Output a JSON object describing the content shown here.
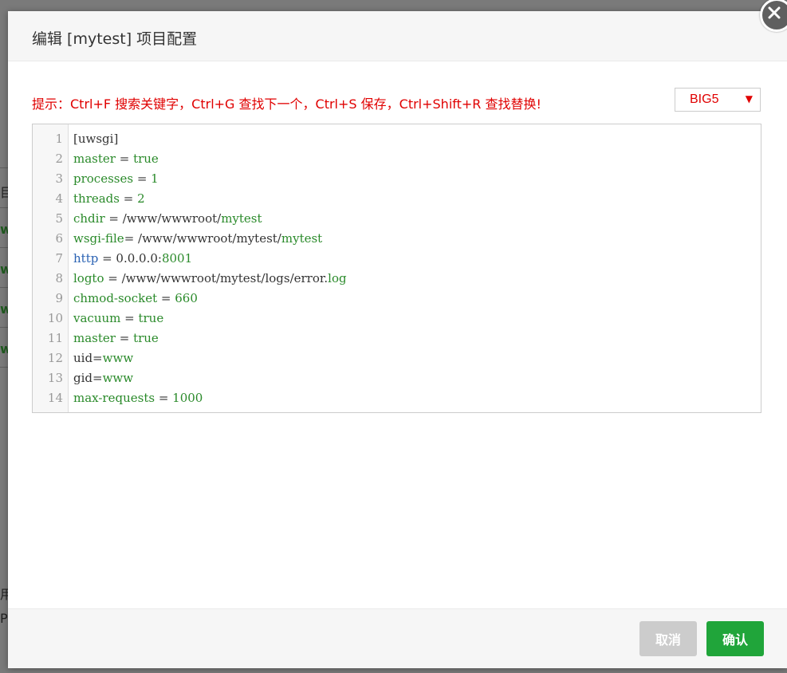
{
  "dialog": {
    "title": "编辑 [mytest] 项目配置",
    "hint": "提示：Ctrl+F 搜索关键字，Ctrl+G 查找下一个，Ctrl+S 保存，Ctrl+Shift+R 查找替换!",
    "encoding": {
      "selected": "BIG5",
      "caret": "▼"
    },
    "lines": [
      {
        "no": "1",
        "parts": [
          [
            "p",
            "[uwsgi]"
          ]
        ]
      },
      {
        "no": "2",
        "parts": [
          [
            "k",
            "master"
          ],
          [
            "p",
            " = "
          ],
          [
            "v",
            "true"
          ]
        ]
      },
      {
        "no": "3",
        "parts": [
          [
            "k",
            "processes"
          ],
          [
            "p",
            " = "
          ],
          [
            "v",
            "1"
          ]
        ]
      },
      {
        "no": "4",
        "parts": [
          [
            "k",
            "threads"
          ],
          [
            "p",
            " = "
          ],
          [
            "v",
            "2"
          ]
        ]
      },
      {
        "no": "5",
        "parts": [
          [
            "k",
            "chdir"
          ],
          [
            "p",
            " = /www/wwwroot/"
          ],
          [
            "v",
            "mytest"
          ]
        ]
      },
      {
        "no": "6",
        "parts": [
          [
            "k",
            "wsgi-file"
          ],
          [
            "p",
            "= /www/wwwroot/mytest/"
          ],
          [
            "v",
            "mytest"
          ]
        ]
      },
      {
        "no": "7",
        "parts": [
          [
            "b",
            "http"
          ],
          [
            "p",
            " = 0.0.0.0:"
          ],
          [
            "v",
            "8001"
          ]
        ]
      },
      {
        "no": "8",
        "parts": [
          [
            "k",
            "logto"
          ],
          [
            "p",
            " = /www/wwwroot/mytest/logs/error."
          ],
          [
            "v",
            "log"
          ]
        ]
      },
      {
        "no": "9",
        "parts": [
          [
            "k",
            "chmod-socket"
          ],
          [
            "p",
            " = "
          ],
          [
            "v",
            "660"
          ]
        ]
      },
      {
        "no": "10",
        "parts": [
          [
            "k",
            "vacuum"
          ],
          [
            "p",
            " = "
          ],
          [
            "v",
            "true"
          ]
        ]
      },
      {
        "no": "11",
        "parts": [
          [
            "k",
            "master"
          ],
          [
            "p",
            " = "
          ],
          [
            "v",
            "true"
          ]
        ]
      },
      {
        "no": "12",
        "parts": [
          [
            "p",
            "uid="
          ],
          [
            "v",
            "www"
          ]
        ]
      },
      {
        "no": "13",
        "parts": [
          [
            "p",
            "gid="
          ],
          [
            "v",
            "www"
          ]
        ]
      },
      {
        "no": "14",
        "parts": [
          [
            "k",
            "max-requests"
          ],
          [
            "p",
            " = "
          ],
          [
            "v",
            "1000"
          ]
        ]
      }
    ],
    "buttons": {
      "cancel": "取消",
      "confirm": "确认"
    }
  },
  "background": {
    "fragments": [
      "目",
      "ww",
      "ww",
      "ww",
      "ww",
      "用",
      "P"
    ]
  },
  "colors": {
    "hint": "#e00000",
    "confirm": "#20a53a",
    "cancel": "#cccccc",
    "keyword": "#2a8a2a",
    "builtin": "#2a62b3"
  }
}
